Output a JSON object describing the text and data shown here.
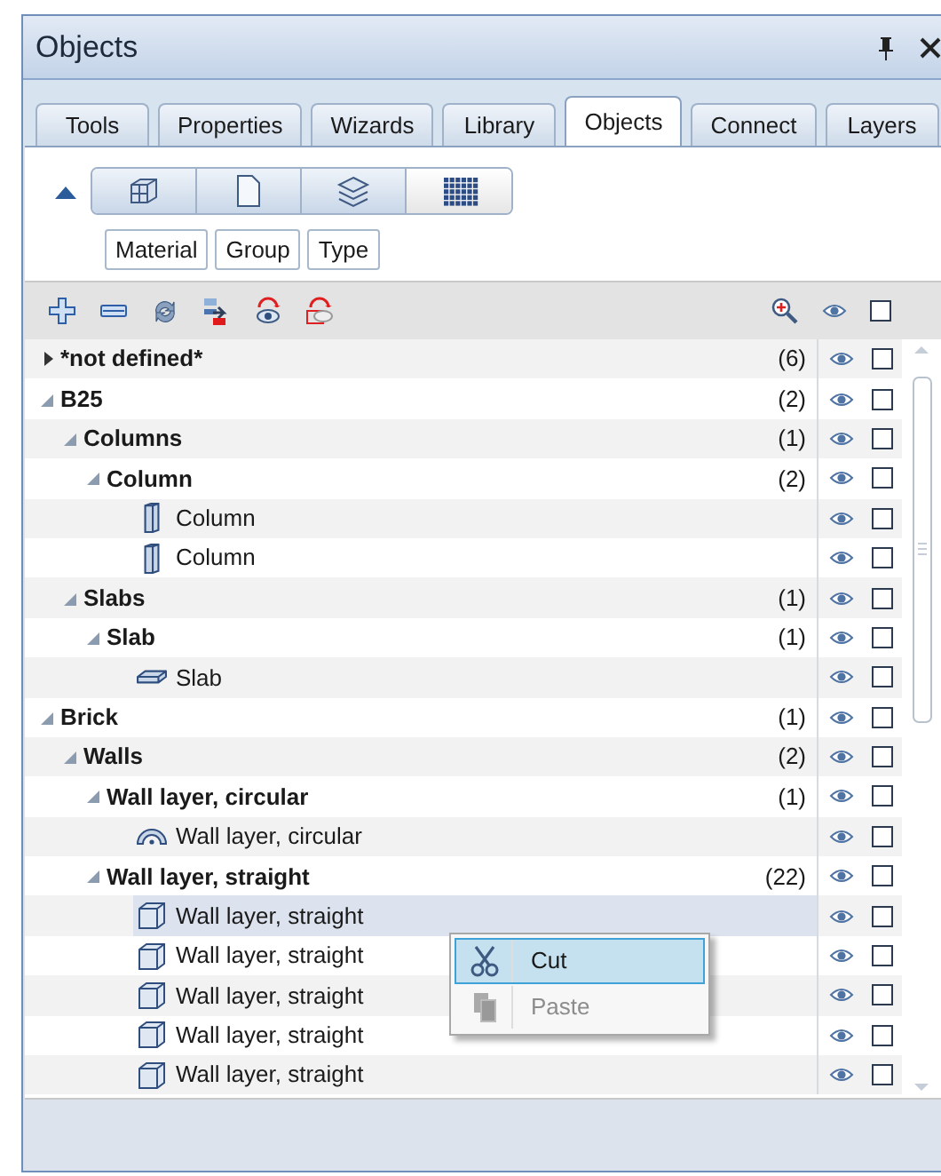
{
  "window": {
    "title": "Objects"
  },
  "tabs": [
    {
      "label": "Tools",
      "selected": false
    },
    {
      "label": "Properties",
      "selected": false
    },
    {
      "label": "Wizards",
      "selected": false
    },
    {
      "label": "Library",
      "selected": false
    },
    {
      "label": "Objects",
      "selected": true
    },
    {
      "label": "Connect",
      "selected": false
    },
    {
      "label": "Layers",
      "selected": false
    }
  ],
  "view_buttons": [
    {
      "kind": "model",
      "selected": false
    },
    {
      "kind": "document",
      "selected": false
    },
    {
      "kind": "layers",
      "selected": false
    },
    {
      "kind": "grid",
      "selected": true
    }
  ],
  "filter_buttons": [
    "Material",
    "Group",
    "Type"
  ],
  "header_checkbox": {
    "checked": false
  },
  "toolbar": [
    {
      "kind": "add"
    },
    {
      "kind": "remove"
    },
    {
      "kind": "refresh"
    },
    {
      "kind": "move"
    },
    {
      "kind": "show"
    },
    {
      "kind": "hide"
    }
  ],
  "tree": [
    {
      "label": "*not defined*",
      "kind": "group",
      "expanded": false,
      "count": "(6)",
      "visible": true,
      "checked": false,
      "selected": false
    },
    {
      "label": "B25",
      "kind": "group",
      "expanded": true,
      "count": "(2)",
      "visible": true,
      "checked": false,
      "selected": false,
      "children": [
        {
          "label": "Columns",
          "kind": "group",
          "expanded": true,
          "count": "(1)",
          "visible": true,
          "checked": false,
          "selected": false,
          "children": [
            {
              "label": "Column",
              "kind": "group",
              "expanded": true,
              "count": "(2)",
              "visible": true,
              "checked": false,
              "selected": false,
              "children": [
                {
                  "label": "Column",
                  "kind": "column",
                  "visible": true,
                  "checked": false,
                  "selected": false
                },
                {
                  "label": "Column",
                  "kind": "column",
                  "visible": true,
                  "checked": false,
                  "selected": false
                }
              ]
            }
          ]
        },
        {
          "label": "Slabs",
          "kind": "group",
          "expanded": true,
          "count": "(1)",
          "visible": true,
          "checked": false,
          "selected": false,
          "children": [
            {
              "label": "Slab",
              "kind": "group",
              "expanded": true,
              "count": "(1)",
              "visible": true,
              "checked": false,
              "selected": false,
              "children": [
                {
                  "label": "Slab",
                  "kind": "slab",
                  "visible": true,
                  "checked": false,
                  "selected": false
                }
              ]
            }
          ]
        }
      ]
    },
    {
      "label": "Brick",
      "kind": "group",
      "expanded": true,
      "count": "(1)",
      "visible": true,
      "checked": false,
      "selected": false,
      "children": [
        {
          "label": "Walls",
          "kind": "group",
          "expanded": true,
          "count": "(2)",
          "visible": true,
          "checked": false,
          "selected": false,
          "children": [
            {
              "label": "Wall layer, circular",
              "kind": "group",
              "expanded": true,
              "count": "(1)",
              "visible": true,
              "checked": false,
              "selected": false,
              "children": [
                {
                  "label": "Wall layer, circular",
                  "kind": "arc",
                  "visible": true,
                  "checked": false,
                  "selected": false
                }
              ]
            },
            {
              "label": "Wall layer, straight",
              "kind": "group",
              "expanded": true,
              "count": "(22)",
              "visible": true,
              "checked": false,
              "selected": false,
              "children": [
                {
                  "label": "Wall layer, straight",
                  "kind": "wall",
                  "visible": true,
                  "checked": false,
                  "selected": true
                },
                {
                  "label": "Wall layer, straight",
                  "kind": "wall",
                  "visible": true,
                  "checked": false,
                  "selected": false
                },
                {
                  "label": "Wall layer, straight",
                  "kind": "wall",
                  "visible": true,
                  "checked": false,
                  "selected": false
                },
                {
                  "label": "Wall layer, straight",
                  "kind": "wall",
                  "visible": true,
                  "checked": false,
                  "selected": false
                },
                {
                  "label": "Wall layer, straight",
                  "kind": "wall",
                  "visible": true,
                  "checked": false,
                  "selected": false
                }
              ]
            }
          ]
        }
      ]
    }
  ],
  "context_menu": [
    {
      "label": "Cut",
      "kind": "cut",
      "selected": true,
      "disabled": false
    },
    {
      "label": "Paste",
      "kind": "paste",
      "selected": false,
      "disabled": true
    }
  ]
}
